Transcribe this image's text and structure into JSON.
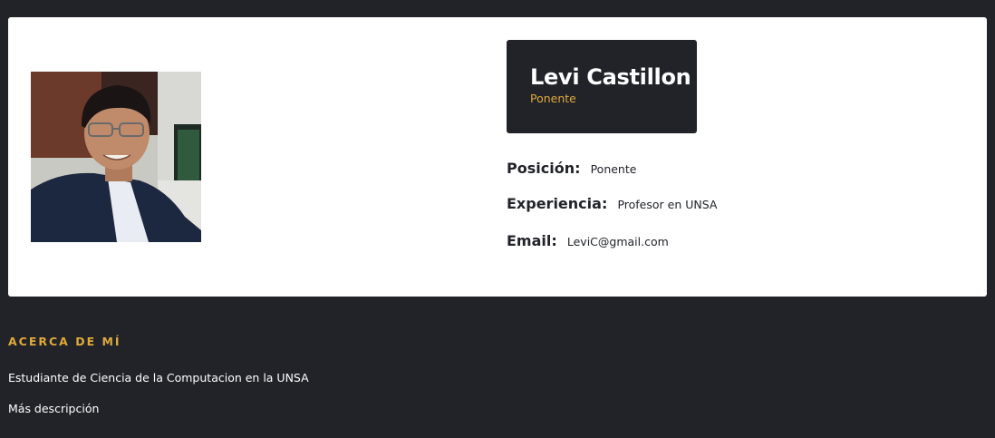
{
  "profile": {
    "name": "Levi Castillon",
    "role": "Ponente",
    "photo_alt": "profile-photo"
  },
  "details": {
    "position_label": "Posición:",
    "position_value": "Ponente",
    "experience_label": "Experiencia:",
    "experience_value": "Profesor en UNSA",
    "email_label": "Email:",
    "email_value": "LeviC@gmail.com"
  },
  "about": {
    "title": "ACERCA DE MÍ",
    "lines": [
      "Estudiante de Ciencia de la Computacion en la UNSA",
      "Más descripción"
    ]
  },
  "colors": {
    "background": "#212329",
    "card": "#ffffff",
    "accent": "#e0a93a"
  }
}
